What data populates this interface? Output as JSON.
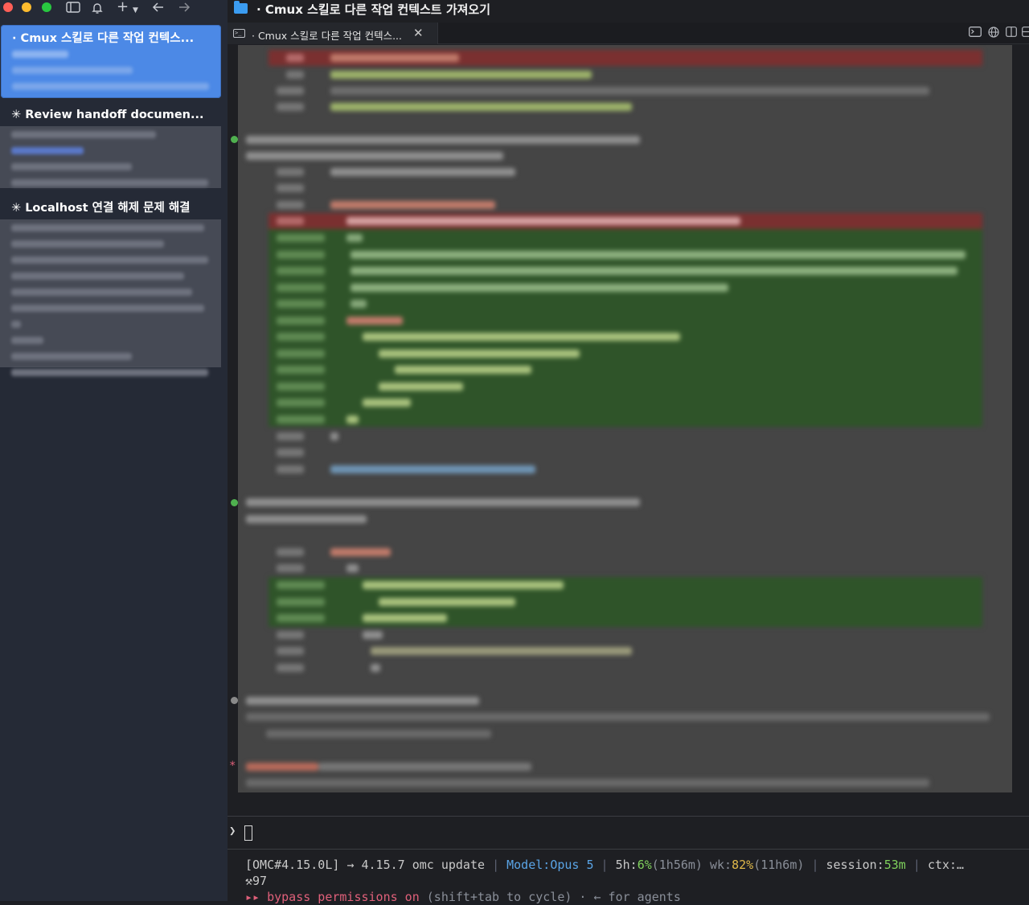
{
  "titlebar": {
    "icons": [
      "close-traffic-light",
      "minimize-traffic-light",
      "zoom-traffic-light",
      "sidebar-toggle-icon",
      "bell-icon",
      "plus-icon",
      "chevron-down-icon",
      "arrow-left-icon",
      "arrow-right-icon"
    ]
  },
  "sidebar": {
    "items": [
      {
        "title": "· Cmux 스킬로 다른 작업 컨텍스...",
        "selected": true
      },
      {
        "title": "✳ Review handoff documen...",
        "selected": false
      },
      {
        "title": "✳ Localhost 연결 해제 문제 해결",
        "selected": false
      }
    ]
  },
  "window": {
    "title": "· Cmux 스킬로 다른 작업 컨텍스트 가져오기"
  },
  "tabs": [
    {
      "label": "· Cmux 스킬로 다른 작업 컨텍스...",
      "close": "✕"
    }
  ],
  "toolbar_right_icons": [
    "terminal-icon",
    "globe-icon",
    "split-icon",
    "layout-icon"
  ],
  "prompt": {
    "char": "❯"
  },
  "statusline": {
    "line1": {
      "omc": "[OMC#4.15.0L]",
      "arrow": "→",
      "update": "4.15.7 omc update",
      "model_label": "Model:",
      "model_value": "Opus 5",
      "fiveh_label": "5h:",
      "fiveh_pct": "6%",
      "fiveh_time": "(1h56m)",
      "wk_label": "wk:",
      "wk_pct": "82%",
      "wk_time": "(11h6m)",
      "session_label": "session:",
      "session_value": "53m",
      "ctx_label": "ctx:…"
    },
    "line2": {
      "tool_icon": "⚒",
      "count": "97"
    },
    "line3": {
      "marker": "▸▸",
      "bypass": "bypass permissions on",
      "rest": "(shift+tab to cycle) · ← for agents"
    }
  },
  "colors": {
    "sidebar_bg": "#252a36",
    "selected_item": "#4c89e6",
    "terminal_bg": "#454545",
    "diff_added": "#2f5429",
    "diff_removed": "#7a3030"
  }
}
